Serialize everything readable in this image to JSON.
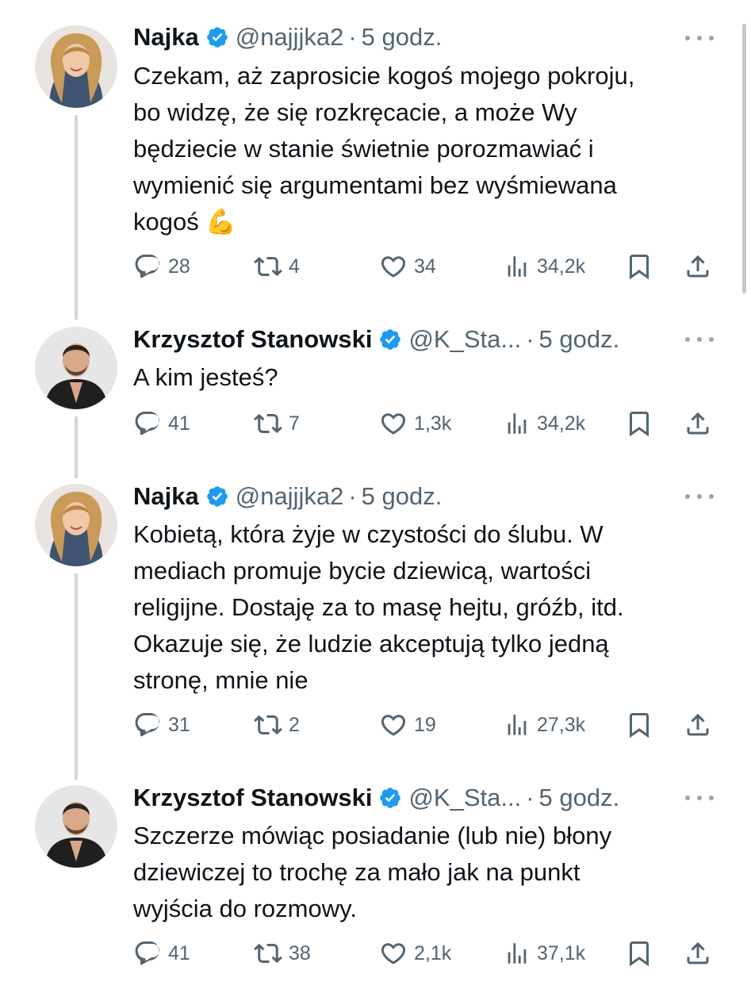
{
  "tweets": [
    {
      "name": "Najka",
      "handle": "@najjjka2",
      "time": "5 godz.",
      "text": "Czekam, aż zaprosicie kogoś mojego pokroju, bo widzę, że się rozkręcacie, a może Wy będziecie w stanie świetnie porozmawiać i wymienić się argumentami bez wyśmiewana kogoś 💪",
      "lines": [
        "Czekam, aż zaprosicie kogoś mojego pokroju,",
        "bo widzę, że się rozkręcacie, a może Wy",
        "będziecie w stanie świetnie porozmawiać i",
        "wymienić się argumentami bez wyśmiewana",
        "kogoś 💪"
      ],
      "replies": "28",
      "retweets": "4",
      "likes": "34",
      "views": "34,2k",
      "avatar": "woman-avatar"
    },
    {
      "name": "Krzysztof Stanowski",
      "handle": "@K_Sta...",
      "time": "5 godz.",
      "text": "A kim jesteś?",
      "lines": [
        "A kim jesteś?"
      ],
      "replies": "41",
      "retweets": "7",
      "likes": "1,3k",
      "views": "34,2k",
      "avatar": "man-avatar"
    },
    {
      "name": "Najka",
      "handle": "@najjjka2",
      "time": "5 godz.",
      "text": "Kobietą, która żyje w czystości do ślubu. W mediach promuje bycie dziewicą, wartości religijne. Dostaję za to masę hejtu, gróźb, itd. Okazuje się, że ludzie akceptują tylko jedną stronę, mnie nie",
      "lines": [
        "Kobietą, która żyje w czystości do ślubu. W",
        "mediach promuje bycie dziewicą, wartości",
        "religijne. Dostaję za to masę hejtu, gróźb, itd.",
        "Okazuje się, że ludzie akceptują tylko jedną",
        "stronę, mnie nie"
      ],
      "replies": "31",
      "retweets": "2",
      "likes": "19",
      "views": "27,3k",
      "avatar": "woman-avatar"
    },
    {
      "name": "Krzysztof Stanowski",
      "handle": "@K_Sta...",
      "time": "5 godz.",
      "text": "Szczerze mówiąc posiadanie (lub nie) błony dziewiczej to trochę za mało jak na punkt wyjścia do rozmowy.",
      "lines": [
        "Szczerze mówiąc posiadanie (lub nie) błony",
        "dziewiczej to trochę za mało jak na punkt",
        "wyjścia do rozmowy."
      ],
      "replies": "41",
      "retweets": "38",
      "likes": "2,1k",
      "views": "37,1k",
      "avatar": "man-avatar"
    }
  ],
  "colors": {
    "text": "#0f1419",
    "secondary": "#536471",
    "verified": "#1d9bf0",
    "thread_line": "#cfd9de"
  },
  "icons": [
    "reply-icon",
    "retweet-icon",
    "like-icon",
    "views-icon",
    "bookmark-icon",
    "share-icon",
    "verified-badge-icon",
    "more-icon"
  ]
}
